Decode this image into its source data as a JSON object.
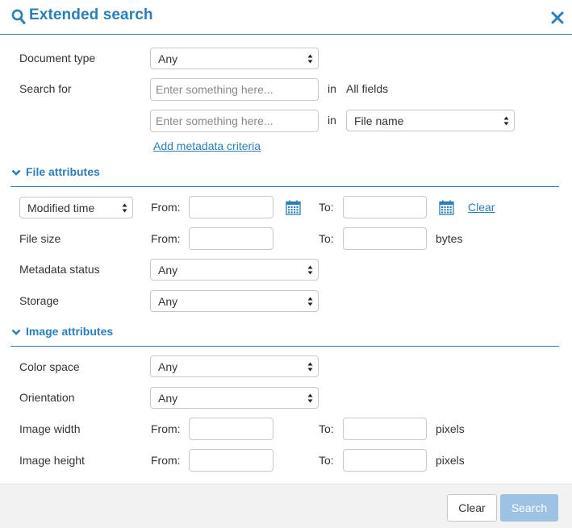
{
  "header": {
    "title": "Extended search"
  },
  "search": {
    "document_type_label": "Document type",
    "document_type_value": "Any",
    "search_for_label": "Search for",
    "placeholder": "Enter something here...",
    "in_label": "in",
    "all_fields": "All fields",
    "field_select_value": "File name",
    "add_metadata_link": "Add metadata criteria"
  },
  "file_attributes": {
    "title": "File attributes",
    "time_select_value": "Modified time",
    "from_label": "From:",
    "to_label": "To:",
    "clear_link": "Clear",
    "file_size_label": "File size",
    "bytes_label": "bytes",
    "metadata_status_label": "Metadata status",
    "metadata_status_value": "Any",
    "storage_label": "Storage",
    "storage_value": "Any"
  },
  "image_attributes": {
    "title": "Image attributes",
    "color_space_label": "Color space",
    "color_space_value": "Any",
    "orientation_label": "Orientation",
    "orientation_value": "Any",
    "image_width_label": "Image width",
    "image_height_label": "Image height",
    "pixels_label": "pixels"
  },
  "footer": {
    "clear_label": "Clear",
    "search_label": "Search"
  },
  "colors": {
    "accent": "#2a7fb8",
    "search_button": "#9dc2e2"
  },
  "icons": [
    "search-icon",
    "close-icon",
    "chevron-down-icon",
    "calendar-icon",
    "select-arrows-icon"
  ]
}
